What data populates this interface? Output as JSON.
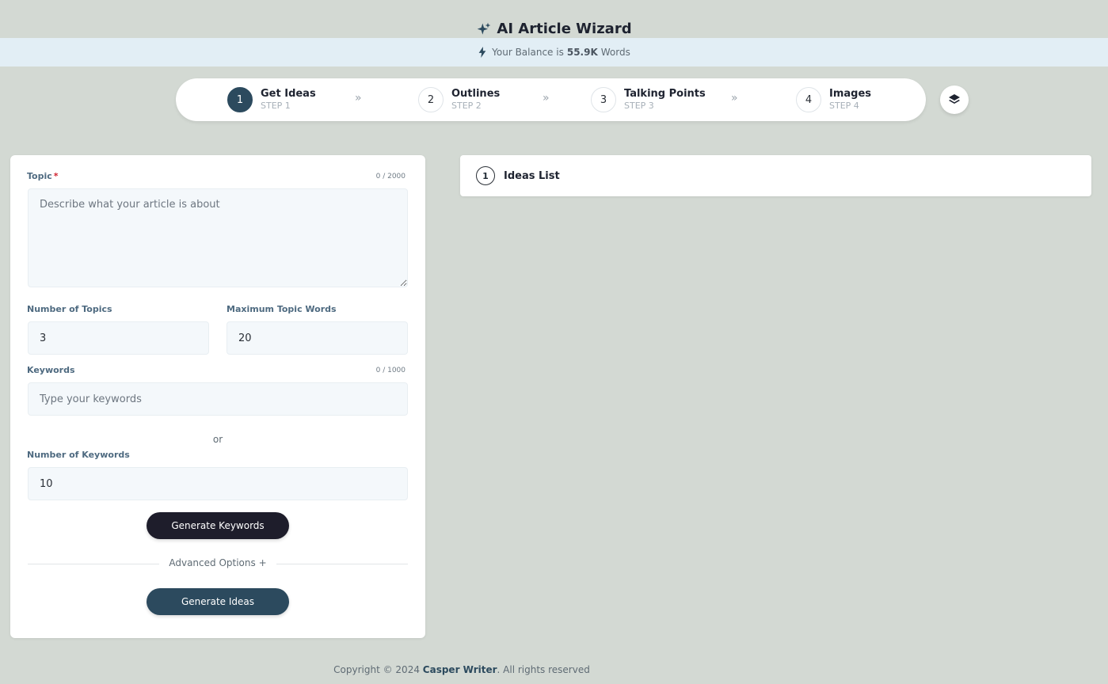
{
  "app": {
    "title": "AI Article Wizard",
    "title_icon": "sparkles-icon"
  },
  "balance": {
    "prefix": "Your Balance is",
    "amount": "55.9K",
    "suffix": "Words",
    "icon": "bolt-icon"
  },
  "steps": [
    {
      "number": "1",
      "label": "Get Ideas",
      "sub": "STEP 1",
      "active": true
    },
    {
      "number": "2",
      "label": "Outlines",
      "sub": "STEP 2",
      "active": false
    },
    {
      "number": "3",
      "label": "Talking Points",
      "sub": "STEP 3",
      "active": false
    },
    {
      "number": "4",
      "label": "Images",
      "sub": "STEP 4",
      "active": false
    }
  ],
  "step_separator": "»",
  "form": {
    "topic": {
      "label": "Topic",
      "required_mark": "*",
      "counter": "0 / 2000",
      "placeholder": "Describe what your article is about",
      "value": ""
    },
    "num_topics": {
      "label": "Number of Topics",
      "value": "3"
    },
    "max_words": {
      "label": "Maximum Topic Words",
      "value": "20"
    },
    "keywords": {
      "label": "Keywords",
      "counter": "0 / 1000",
      "placeholder": "Type your keywords",
      "value": ""
    },
    "or_text": "or",
    "num_keywords": {
      "label": "Number of Keywords",
      "value": "10"
    },
    "generate_keywords_label": "Generate Keywords",
    "advanced_options_label": "Advanced Options +",
    "generate_ideas_label": "Generate Ideas"
  },
  "ideas_list": {
    "number": "1",
    "title": "Ideas List"
  },
  "footer": {
    "prefix": "Copyright © 2024",
    "brand": "Casper Writer",
    "suffix": ". All rights reserved"
  },
  "colors": {
    "accent": "#2c4a5e",
    "dark_button": "#1e1d2b",
    "background": "#d3d9d3",
    "balance_bar": "#e2eef5",
    "required": "#d0232f"
  }
}
